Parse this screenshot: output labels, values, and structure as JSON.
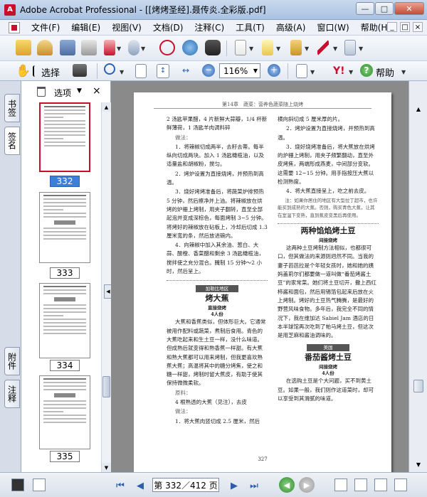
{
  "window": {
    "title": "Adobe Acrobat Professional - [[烤烤圣经].聂传炎.全彩版.pdf]",
    "buttons": {
      "minimize": "—",
      "maximize": "□",
      "close": "✕"
    }
  },
  "menu": {
    "items": [
      "文件(F)",
      "编辑(E)",
      "视图(V)",
      "文档(D)",
      "注释(C)",
      "工具(T)",
      "高级(A)",
      "窗口(W)",
      "帮助(H)"
    ],
    "doc_buttons": [
      "_",
      "□",
      "×"
    ]
  },
  "toolbar2": {
    "select_label": "选择",
    "zoom_value": "116%",
    "help_label": "帮助"
  },
  "nav_tabs": [
    "书签",
    "签名",
    "附件",
    "注释"
  ],
  "thumb_panel": {
    "options_label": "选项",
    "close": "×",
    "pages": [
      {
        "label": "332",
        "selected": true
      },
      {
        "label": "333",
        "selected": false
      },
      {
        "label": "334",
        "selected": false
      },
      {
        "label": "335",
        "selected": false
      }
    ]
  },
  "document": {
    "running_head": "第14章　蔬菜：营养色蔬菜随上烧烤",
    "page_number": "327",
    "left_column": [
      "2 汤匙苹果醋，4 片新鲜大蒜瓣，1/4 杯新鲜薄荷，1 汤匙羊肉调料碎",
      "做法：",
      "1．将辣椒切成两半，去籽去蒂。每半纵向切成两块。加入 1 汤匙橄榄油，以及适量盐和胡椒粉，搅匀。",
      "2．烤炉设置为直接烧烤，并预热到高温。",
      "3．烧好烤烤准备后，将蔬菜炉排预热 5 分钟，然后擦净并上油。将辣椒放在烘烤的炉栅上烤制，用夹子翻转，直至全部起泡并变成深棕色，每面烤制 3~5 分钟。将烤好的辣椒放在砧板上，冷却后切成 1.3 厘米宽的条，然后放进碗内。",
      "4．向辣椒中加入其余油、葱白、大蒜、酸橙、香菜醋和剩余 3 汤匙橄榄油，搅拌使之充分混合。腌制 15 分钟～2 小时，然后呈上。"
    ],
    "left_recipe": {
      "badge": "加勒比地区",
      "title": "烤大蕉",
      "meta1": "直接烧烤",
      "meta2": "4人份",
      "body": [
        "大蕉和香蕉类似，但体形巨大。它通常被用作配料或蔬菜，煮制后食用。青色的大蕉吃起来和生土豆一样，没什么味道。但成熟后就变得和熟香蕉一样甜。有大蕉和熟大蕉都可以用来烤制，但我更喜欢熟蕉大蕉；高温将其中的糖分烤焦，使之和糖一样甜，烤制时留大蕉皮，有助于使其保持微微柔软。",
        "原料：",
        "4 根熟透的大蕉（见注），去皮",
        "做法：",
        "1．将大蕉肉竖切成 2.5 厘米，然后"
      ]
    },
    "right_column": [
      "横向斜切成 5 厘米厚的片。",
      "2．烤炉设置为直接烧烤，并预热到高温。",
      "3．烧好烧烤准备后，将大蕉放在烘烤的炉栅上烤制，用夹子频繁翻动，直至外皮烤焦，两端形成燕麦，中间部分变软。这需要 12~15 分钟。用手指按压大蕉以检测熟度。",
      "4．将大蕉直接呈上，吃之前去皮。"
    ],
    "right_note": "注：如果你居住的地区有大型拉丁超市，也许能买到成熟的大蕉。否则，购买青色大蕉，让其在室温下变熟，直到蕉皮变黑后再使用。",
    "right_recipe1": {
      "title": "两种馅焰烤土豆",
      "meta": "间接烧烤",
      "body": [
        "这两种土豆烤制方法相似，也都很可口，但其做法的来源则迥然不同。当我的妻子芭芭拉是个年轻女孩时，她和她的姨妈盖莉尔们都要做一道叫做“番茄烤酱土豆”的家常菜。她们将土豆切开，撒上西红柿酱和面包，然后用锡箔包起来后放在火上烤制。烤好的土豆热气腾腾，是最好的野营风味食物。多年后，我完全不同的情况下，我在维加达 Sabiel Jam 酒店的日本半球馆再次吃到了帕马烤土豆，但这次是用芝麻和酱油调味的。"
      ]
    },
    "right_recipe2": {
      "badge": "美国",
      "title": "番茄酱烤土豆",
      "meta1": "间接烧烤",
      "meta2": "4人份",
      "body": [
        "在选购土豆是个大问题，买不到黄土豆。如果一般，我们则作这道菜时，却可以享受到其滑腻的味道。"
      ]
    }
  },
  "statusbar": {
    "page_field": "第 332／412 页"
  },
  "colors": {
    "accent_red": "#c8102e",
    "selection_blue": "#3c7fd9",
    "doc_background": "#8a8a8a"
  }
}
